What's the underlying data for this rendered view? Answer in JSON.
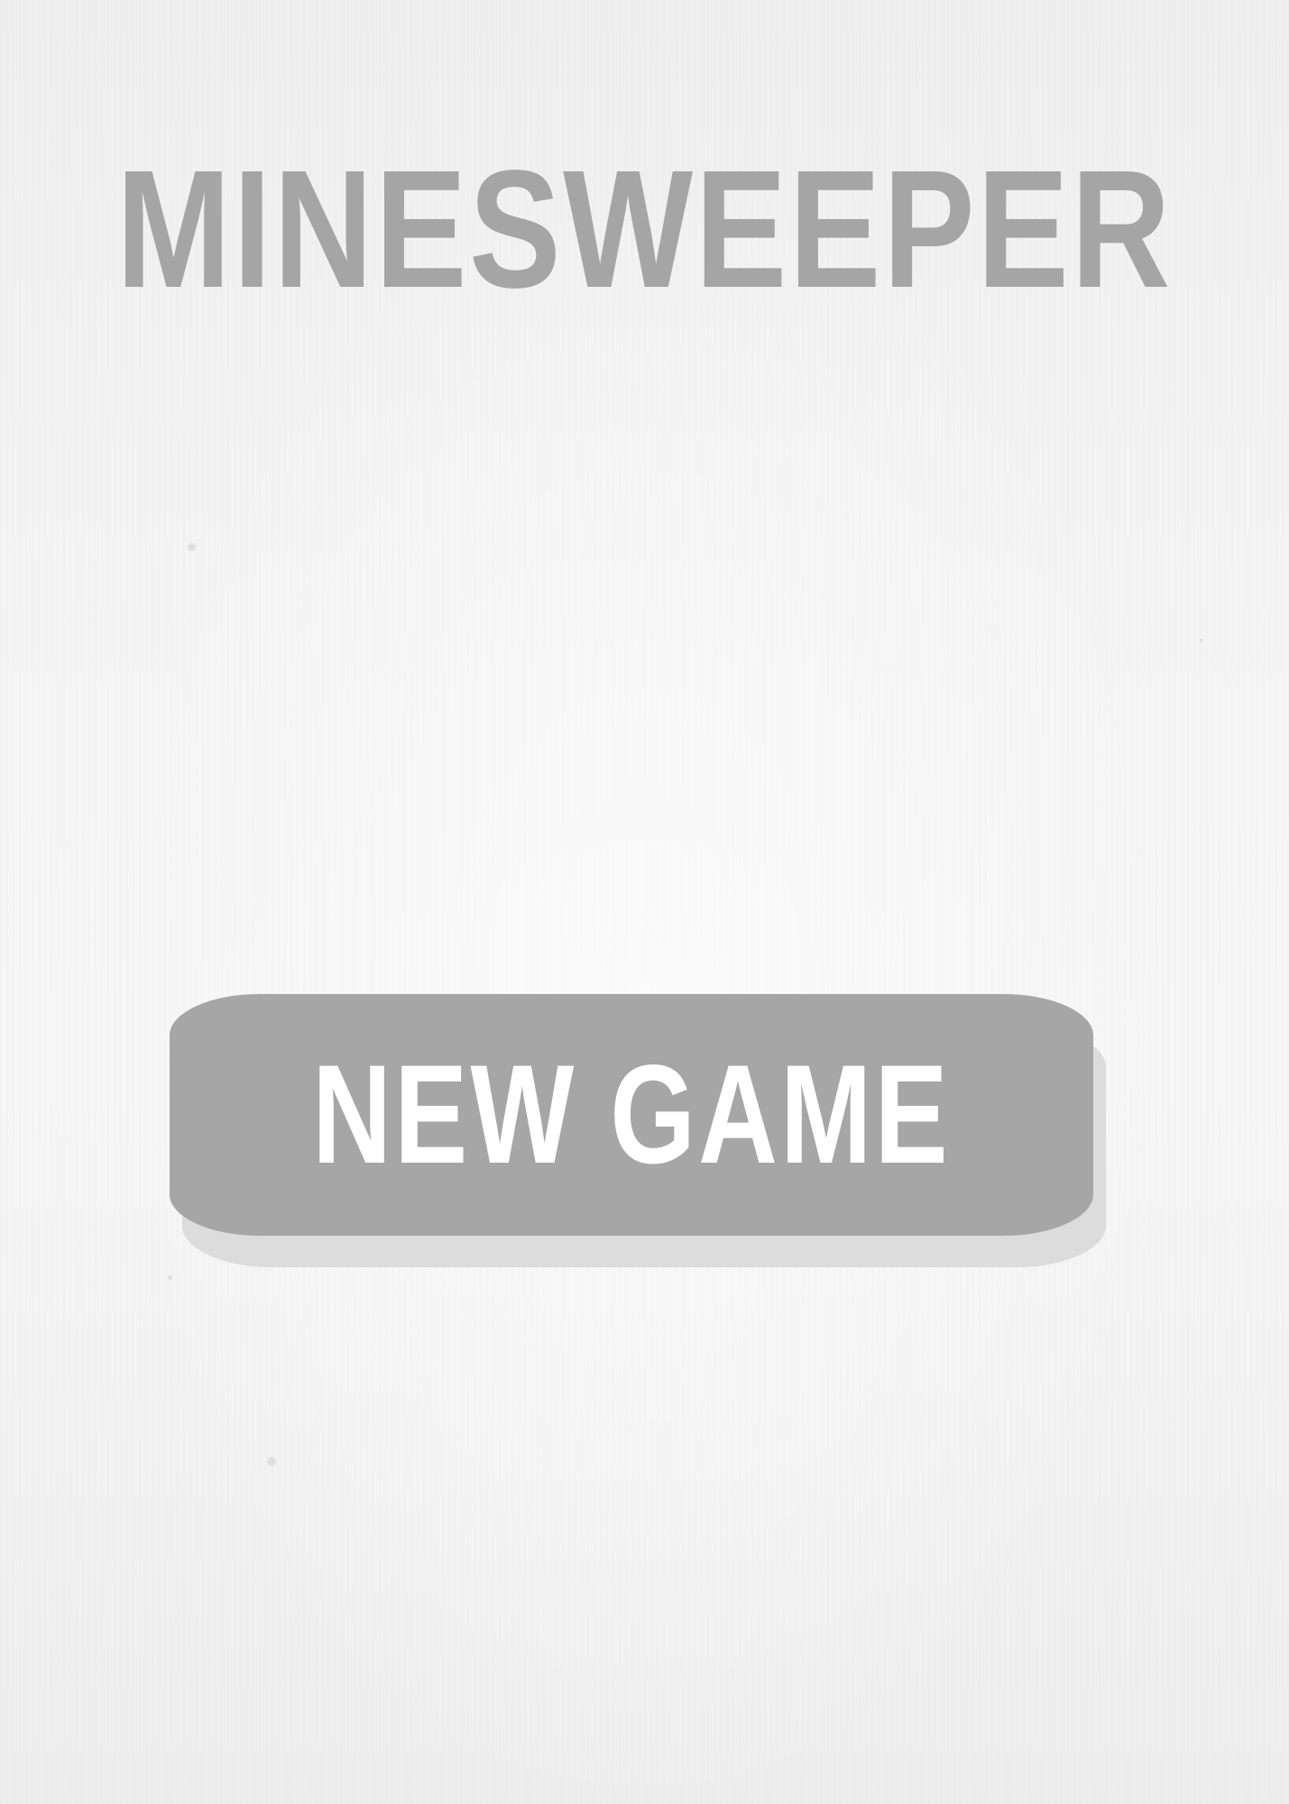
{
  "screen": "title",
  "title": "MINESWEEPER",
  "new_game_button": {
    "label": "NEW GAME"
  },
  "colors": {
    "background": "#f3f3f3",
    "title": "#a5a5a5",
    "button": "#a6a6a6",
    "button_shadow": "#dcdcdc",
    "button_text": "#ffffff"
  }
}
